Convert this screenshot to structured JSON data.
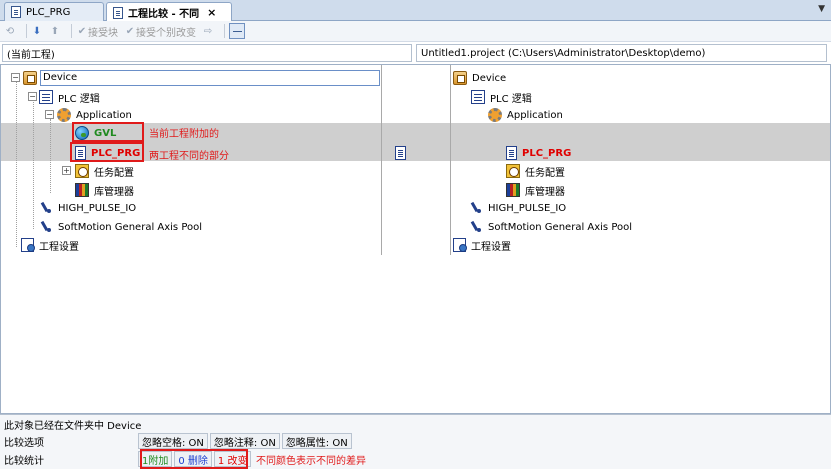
{
  "tabs": [
    {
      "label": "PLC_PRG",
      "active": false
    },
    {
      "label": "工程比较 - 不同",
      "active": true,
      "close": "×"
    }
  ],
  "tab_menu_glyph": "▼",
  "toolbar": {
    "accept_block": "接受块",
    "accept_single": "接受个别改变"
  },
  "paths": {
    "left": "(当前工程)",
    "right": "Untitled1.project (C:\\Users\\Administrator\\Desktop\\demo)"
  },
  "left_tree": {
    "device": "Device",
    "plc_logic": "PLC 逻辑",
    "application": "Application",
    "gvl": "GVL",
    "plc_prg": "PLC_PRG",
    "task_config": "任务配置",
    "lib_manager": "库管理器",
    "high_pulse": "HIGH_PULSE_IO",
    "softmotion": "SoftMotion General Axis Pool",
    "project_settings": "工程设置"
  },
  "right_tree": {
    "device": "Device",
    "plc_logic": "PLC 逻辑",
    "application": "Application",
    "plc_prg": "PLC_PRG",
    "task_config": "任务配置",
    "lib_manager": "库管理器",
    "high_pulse": "HIGH_PULSE_IO",
    "softmotion": "SoftMotion General Axis Pool",
    "project_settings": "工程设置"
  },
  "annotations": {
    "added_note": "当前工程附加的",
    "diff_note": "两工程不同的部分",
    "color_note": "不同颜色表示不同的差异"
  },
  "footer": {
    "status": "此对象已经在文件夹中 Device",
    "options_label": "比较选项",
    "options": [
      "忽略空格: ON",
      "忽略注释: ON",
      "忽略属性: ON"
    ],
    "stats_label": "比较统计",
    "stats": {
      "added": "1附加",
      "removed": "0 删除",
      "changed": "1 改变"
    }
  },
  "colors": {
    "added": "#1f8a1f",
    "removed": "#1d3fd0",
    "changed": "#e00000",
    "highlight": "#cfcfcf",
    "annotation": "#e01a1a"
  }
}
